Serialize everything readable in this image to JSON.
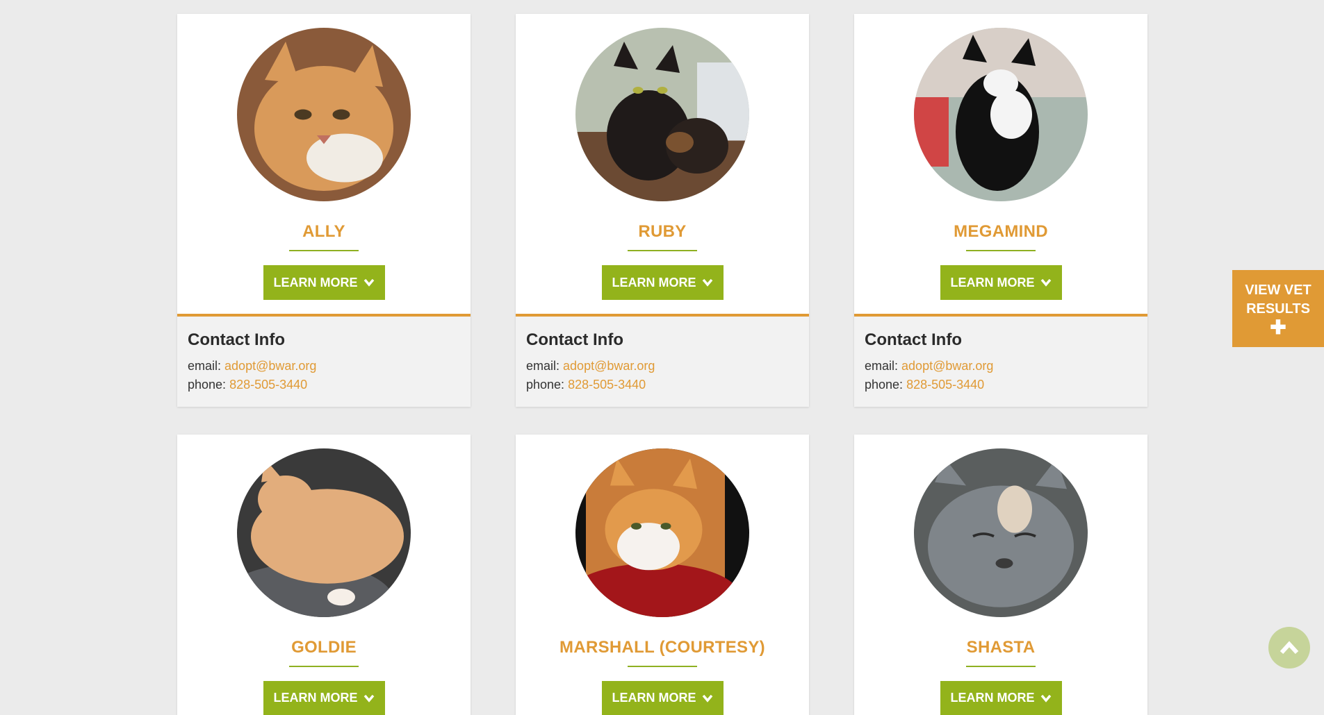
{
  "pets": [
    {
      "name": "ALLY",
      "photo": "orange-white-cat-photo",
      "has_contact": true
    },
    {
      "name": "RUBY",
      "photo": "tortoiseshell-cat-photo",
      "has_contact": true
    },
    {
      "name": "MEGAMIND",
      "photo": "tuxedo-cat-photo",
      "has_contact": true
    },
    {
      "name": "GOLDIE",
      "photo": "orange-tabby-cat-photo",
      "has_contact": false
    },
    {
      "name": "MARSHALL (COURTESY)",
      "photo": "orange-white-cat-photo-2",
      "has_contact": false
    },
    {
      "name": "SHASTA",
      "photo": "dilute-calico-cat-photo",
      "has_contact": false
    }
  ],
  "learn_more_label": "LEARN MORE",
  "contact": {
    "heading": "Contact Info",
    "email_label": "email:",
    "email": "adopt@bwar.org",
    "phone_label": "phone:",
    "phone": "828-505-3440"
  },
  "vet_button": {
    "line1": "VIEW VET",
    "line2": "RESULTS",
    "plus": "✚"
  },
  "colors": {
    "accent": "#e09a35",
    "green": "#93b31b",
    "background": "#ebebeb"
  }
}
